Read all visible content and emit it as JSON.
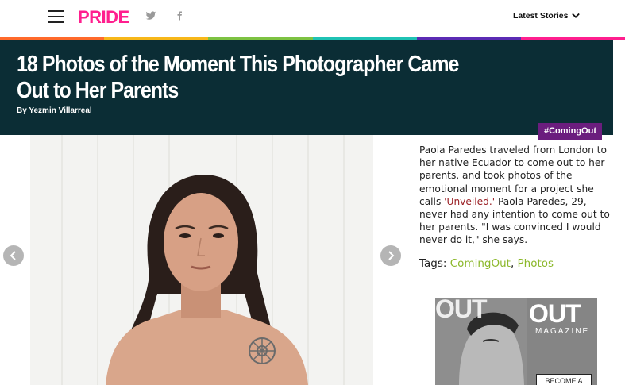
{
  "nav": {
    "logo": "PRIDE",
    "latest_label": "Latest Stories"
  },
  "rainbow_colors": [
    "#ff6a2b",
    "#f7b719",
    "#7dc242",
    "#1fc2b4",
    "#5b2bb4",
    "#ff1f8e"
  ],
  "article": {
    "title": "18 Photos of the Moment This Photographer Came Out to Her Parents",
    "byline": "By Yezmin Villarreal",
    "tag_badge": "#ComingOut",
    "desc_part1": "Paola Paredes traveled from London to her native Ecuador to come out to her parents, and took photos of the emotional moment for a project she calls ",
    "desc_link": "'Unveiled.'",
    "desc_part2": " Paola Paredes, 29, never had any intention to come out to her parents. \"I was convinced I would never do it,\" she says.",
    "tags_label": "Tags:",
    "tags": [
      "ComingOut",
      "Photos"
    ],
    "tags_sep": ","
  },
  "ad": {
    "out_left": "OUT",
    "out_big": "OUT",
    "magazine": "MAGAZINE",
    "button": "BECOME A"
  },
  "colors": {
    "hero_bg": "#0b2d35",
    "brand_pink": "#ff1f8e",
    "badge_purple": "#6b1d7e",
    "tag_green": "#8cb82b",
    "link_red": "#9a1f24"
  },
  "icons": {
    "menu": "hamburger-menu-icon",
    "twitter": "twitter-icon",
    "facebook": "facebook-icon",
    "chevron": "chevron-down-icon",
    "prev": "chevron-left-icon",
    "next": "chevron-right-icon"
  }
}
